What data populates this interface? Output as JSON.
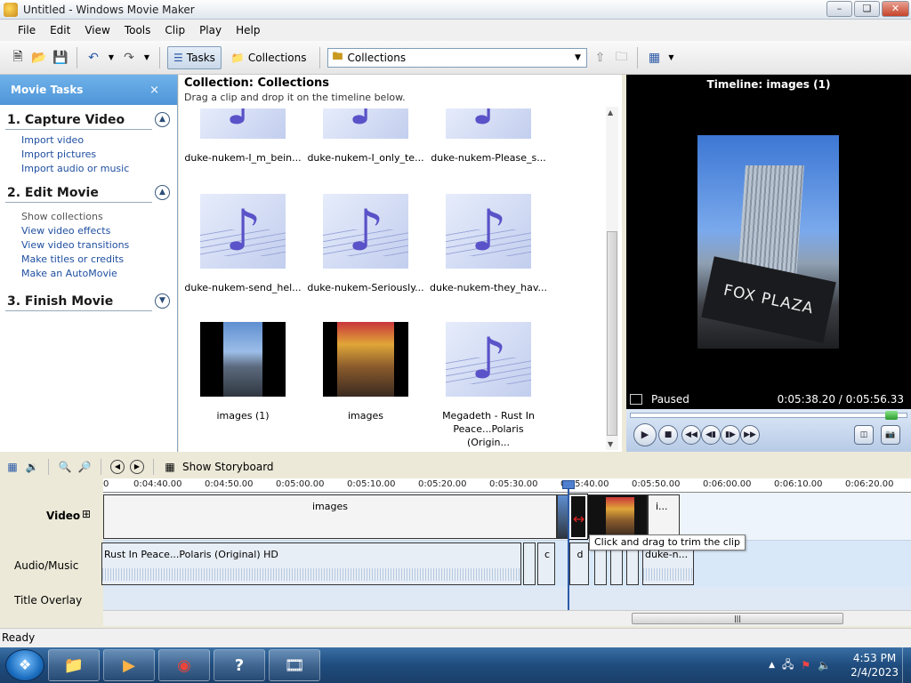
{
  "window": {
    "title": "Untitled - Windows Movie Maker",
    "min": "–",
    "max": "❏",
    "close": "✕"
  },
  "menu": [
    "File",
    "Edit",
    "View",
    "Tools",
    "Clip",
    "Play",
    "Help"
  ],
  "toolbar": {
    "tasks_label": "Tasks",
    "collections_label": "Collections",
    "combo_value": "Collections"
  },
  "tasks": {
    "header": "Movie Tasks",
    "close": "×",
    "capture": {
      "title": "1. Capture Video",
      "links": [
        "Import video",
        "Import pictures",
        "Import audio or music"
      ]
    },
    "edit": {
      "title": "2. Edit Movie",
      "links": [
        "Show collections",
        "View video effects",
        "View video transitions",
        "Make titles or credits",
        "Make an AutoMovie"
      ]
    },
    "finish": {
      "title": "3. Finish Movie"
    }
  },
  "collection": {
    "title": "Collection: Collections",
    "hint": "Drag a clip and drop it on the timeline below.",
    "items": [
      {
        "label": "duke-nukem-I_m_bein...",
        "kind": "audio"
      },
      {
        "label": "duke-nukem-I_only_te...",
        "kind": "audio"
      },
      {
        "label": "duke-nukem-Please_s...",
        "kind": "audio"
      },
      {
        "label": "duke-nukem-send_hel...",
        "kind": "audio"
      },
      {
        "label": "duke-nukem-Seriously...",
        "kind": "audio"
      },
      {
        "label": "duke-nukem-they_hav...",
        "kind": "audio"
      },
      {
        "label": "images (1)",
        "kind": "photo"
      },
      {
        "label": "images",
        "kind": "photo"
      },
      {
        "label": "Megadeth - Rust In Peace...Polaris (Origin...",
        "kind": "audio"
      }
    ]
  },
  "preview": {
    "title": "Timeline: images (1)",
    "status": "Paused",
    "time": "0:05:38.20 / 0:05:56.33",
    "sign_text": "FOX PLAZA"
  },
  "timeline": {
    "show_storyboard": "Show Storyboard",
    "ticks": [
      "0",
      "0:04:40.00",
      "0:04:50.00",
      "0:05:00.00",
      "0:05:10.00",
      "0:05:20.00",
      "0:05:30.00",
      "0:05:40.00",
      "0:05:50.00",
      "0:06:00.00",
      "0:06:10.00",
      "0:06:20.00"
    ],
    "rows": {
      "video": "Video",
      "audio": "Audio/Music",
      "title": "Title Overlay"
    },
    "video_clip_label": "images",
    "video_clip_end": "i...",
    "audio_clip_label": "Rust In Peace...Polaris (Original) HD",
    "audio_small": [
      "c",
      "d"
    ],
    "audio_last": "duke-n...",
    "tooltip": "Click and drag to trim the clip",
    "expand": "⊞"
  },
  "status": {
    "text": "Ready"
  },
  "taskbar": {
    "time": "4:53 PM",
    "date": "2/4/2023"
  }
}
